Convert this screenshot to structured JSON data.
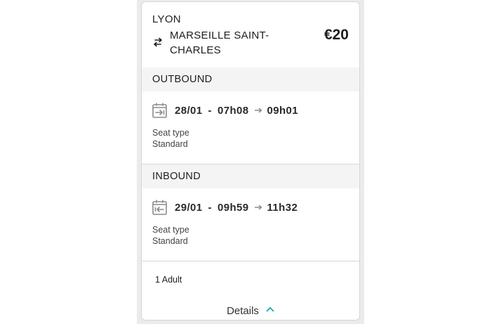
{
  "route": {
    "origin": "LYON",
    "destination": "MARSEILLE SAINT-CHARLES",
    "price": "€20"
  },
  "outbound": {
    "header": "OUTBOUND",
    "date": "28/01",
    "separator": "-",
    "depart": "07h08",
    "arrive": "09h01",
    "seat_label": "Seat type",
    "seat_value": "Standard"
  },
  "inbound": {
    "header": "INBOUND",
    "date": "29/01",
    "separator": "-",
    "depart": "09h59",
    "arrive": "11h32",
    "seat_label": "Seat type",
    "seat_value": "Standard"
  },
  "passengers": "1 Adult",
  "details": {
    "label": "Details"
  },
  "colors": {
    "accent": "#1aa6b7",
    "header_bg": "#f4f4f4",
    "divider": "#d6d6d6",
    "icon_gray": "#8c8c8c"
  },
  "icons": {
    "swap": "swap-arrows-icon",
    "outbound_calendar": "calendar-outbound-icon",
    "inbound_calendar": "calendar-inbound-icon",
    "arrow": "arrow-right-icon",
    "chevron": "chevron-up-icon"
  }
}
